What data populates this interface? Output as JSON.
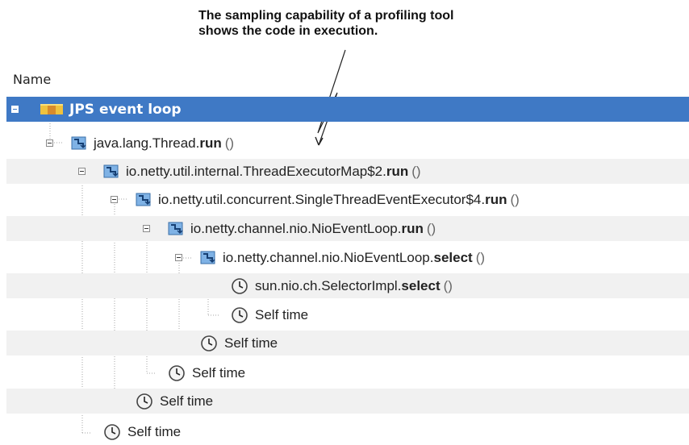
{
  "annotation": {
    "line1": "The sampling capability of a profiling tool",
    "line2": "shows the code in execution."
  },
  "column_header": "Name",
  "colors": {
    "selection": "#3f79c5",
    "row_shade": "#f1f1f1",
    "guide": "#a6a6a6"
  },
  "tree": {
    "root": {
      "label": "JPS event loop",
      "icon": "thread-group-icon"
    },
    "rows": [
      {
        "prefix": "java.lang.Thread.",
        "method": "run",
        "suffix": "()",
        "icon": "method-icon"
      },
      {
        "prefix": "io.netty.util.internal.ThreadExecutorMap$2.",
        "method": "run",
        "suffix": "()",
        "icon": "method-icon"
      },
      {
        "prefix": "io.netty.util.concurrent.SingleThreadEventExecutor$4.",
        "method": "run",
        "suffix": "()",
        "icon": "method-icon"
      },
      {
        "prefix": "io.netty.channel.nio.NioEventLoop.",
        "method": "run",
        "suffix": "()",
        "icon": "method-icon"
      },
      {
        "prefix": "io.netty.channel.nio.NioEventLoop.",
        "method": "select",
        "suffix": "()",
        "icon": "method-icon"
      },
      {
        "prefix": "sun.nio.ch.SelectorImpl.",
        "method": "select",
        "suffix": "()",
        "icon": "clock-icon"
      },
      {
        "label": "Self time",
        "icon": "clock-icon"
      },
      {
        "label": "Self time",
        "icon": "clock-icon"
      },
      {
        "label": "Self time",
        "icon": "clock-icon"
      },
      {
        "label": "Self time",
        "icon": "clock-icon"
      },
      {
        "label": "Self time",
        "icon": "clock-icon"
      }
    ]
  }
}
